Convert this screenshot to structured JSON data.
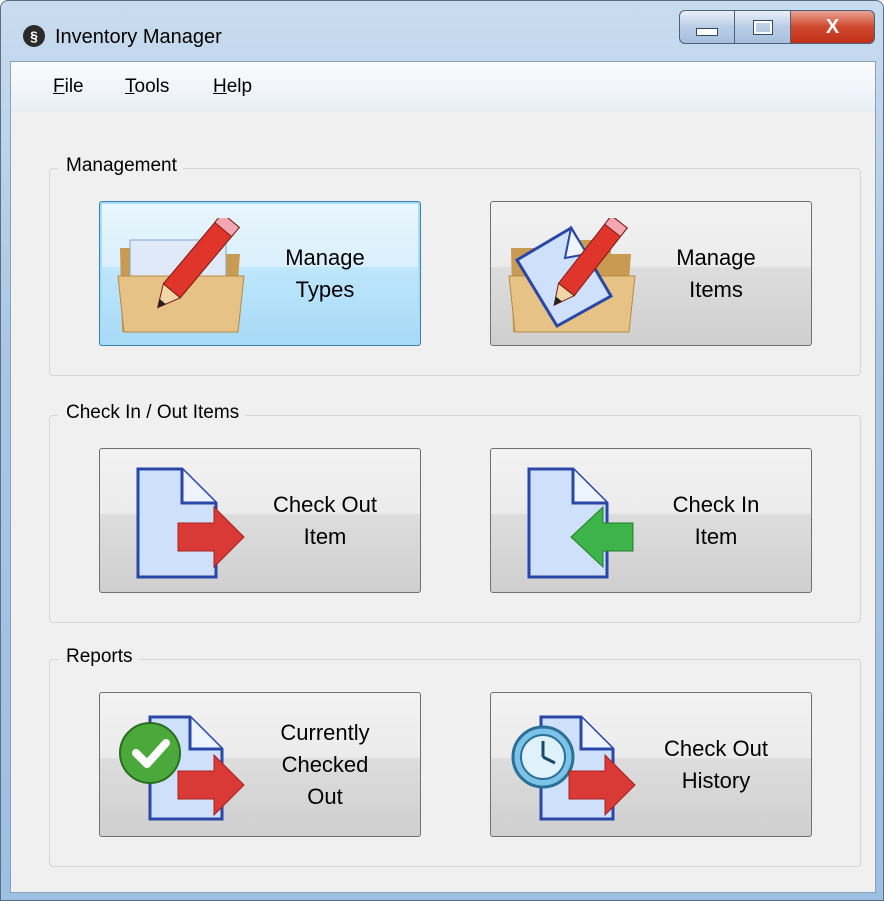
{
  "window": {
    "title": "Inventory Manager",
    "close_glyph": "X"
  },
  "menu": {
    "file": {
      "accel": "F",
      "rest": "ile"
    },
    "tools": {
      "accel": "T",
      "rest": "ools"
    },
    "help": {
      "accel": "H",
      "rest": "elp"
    }
  },
  "groups": {
    "management": {
      "label": "Management",
      "manage_types": {
        "line1": "Manage",
        "line2": "Types",
        "icon": "folder-pencil-icon"
      },
      "manage_items": {
        "line1": "Manage",
        "line2": "Items",
        "icon": "folder-document-pencil-icon"
      }
    },
    "checkinout": {
      "label": "Check In / Out Items",
      "check_out": {
        "line1": "Check Out",
        "line2": "Item",
        "icon": "document-arrow-right-icon"
      },
      "check_in": {
        "line1": "Check In",
        "line2": "Item",
        "icon": "document-arrow-left-icon"
      }
    },
    "reports": {
      "label": "Reports",
      "currently_checked_out": {
        "line1": "Currently",
        "line2": "Checked",
        "line3": "Out",
        "icon": "document-check-arrow-icon"
      },
      "check_out_history": {
        "line1": "Check Out",
        "line2": "History",
        "icon": "document-clock-arrow-icon"
      }
    }
  },
  "colors": {
    "focus_border": "#3c7fb1",
    "arrow_red": "#d93a36",
    "arrow_green": "#3cb44a",
    "check_green": "#4aa93a",
    "doc_blue": "#cfe0fb"
  }
}
